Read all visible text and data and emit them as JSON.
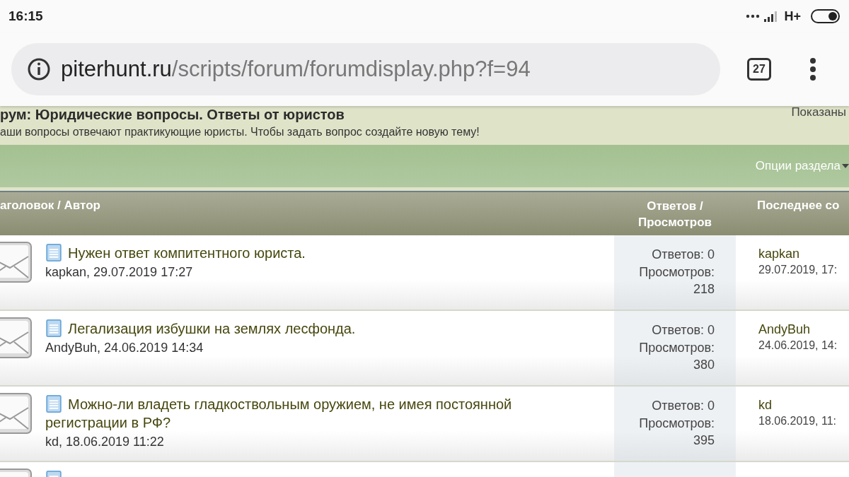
{
  "status_bar": {
    "time": "16:15",
    "network": "H+"
  },
  "address_bar": {
    "domain": "piterhunt.ru",
    "path": "/scripts/forum/forumdisplay.php?f=94",
    "tab_count": "27"
  },
  "forum": {
    "title": "рум: Юридические вопросы. Ответы от юристов",
    "description": "аши вопросы отвечают практикующие юристы. Чтобы задать вопрос создайте новую тему!",
    "showing_label": "Показаны",
    "options_label": "Опции раздела"
  },
  "columns": [
    "аголовок / Автор",
    "Ответов / Просмотров",
    "Последнее со"
  ],
  "threads": [
    {
      "title": "Нужен ответ компитентного юриста.",
      "author_date": "kapkan, 29.07.2019 17:27",
      "replies": "Ответов: 0",
      "views": "Просмотров: 218",
      "last_author": "kapkan",
      "last_date": "29.07.2019, 17:"
    },
    {
      "title": "Легализация избушки на землях лесфонда.",
      "author_date": "AndyBuh, 24.06.2019 14:34",
      "replies": "Ответов: 0",
      "views": "Просмотров: 380",
      "last_author": "AndyBuh",
      "last_date": "24.06.2019, 14:"
    },
    {
      "title": "Можно-ли владеть гладкоствольным оружием, не имея постоянной регистрации в РФ?",
      "author_date": "kd, 18.06.2019 11:22",
      "replies": "Ответов: 0",
      "views": "Просмотров: 395",
      "last_author": "kd",
      "last_date": "18.06.2019, 11:"
    }
  ]
}
